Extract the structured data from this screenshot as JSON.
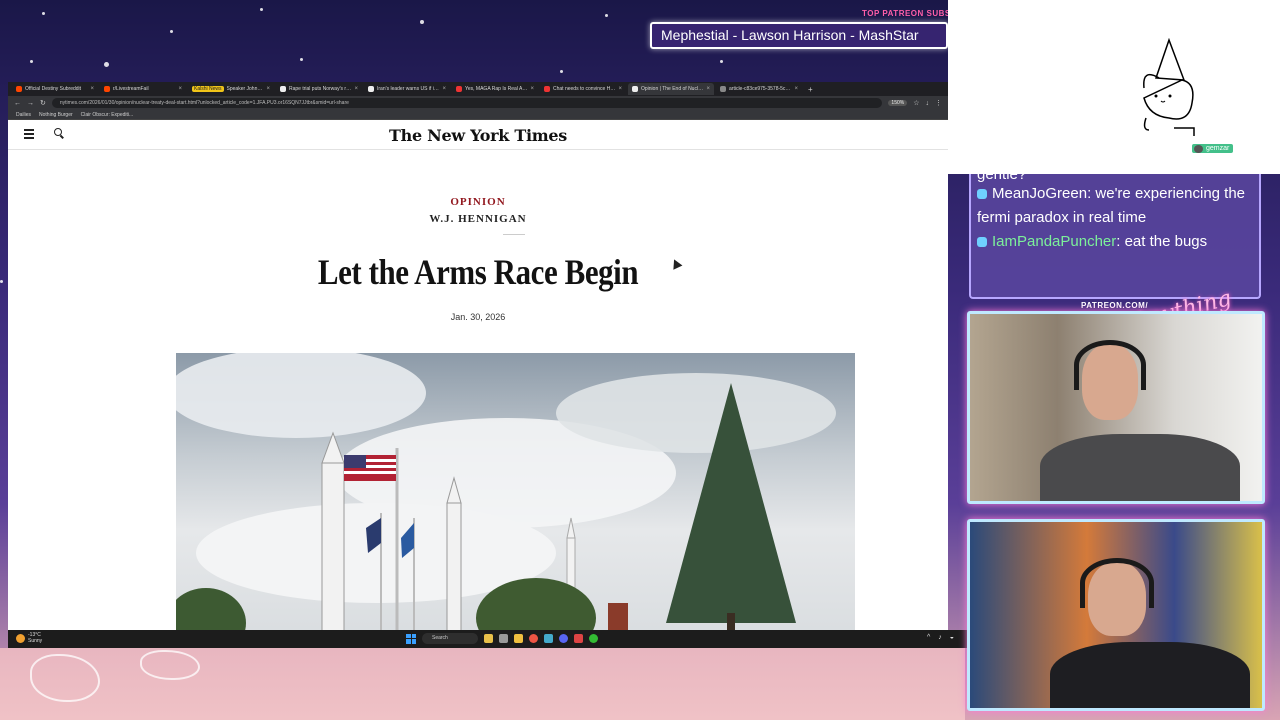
{
  "overlay": {
    "patreon_subs_label": "TOP PATREON SUBS",
    "marquee_text": "Mephestial - Lawson Harrison - MashStar",
    "patreon_url_label": "PATREON.COM/",
    "logo_text": "Anything Else?",
    "user_tag": "gemzar"
  },
  "browser": {
    "tabs": [
      {
        "label": "Official Destiny Subreddit",
        "color": "#ff4500",
        "active": false
      },
      {
        "label": "r/LivestreamFail",
        "color": "#ff4500",
        "active": false
      },
      {
        "label": "Speaker Johnson is 'confident' ...",
        "color": "#555",
        "active": false,
        "badge": "Kalshi News"
      },
      {
        "label": "Rape trial puts Norway's royal ...",
        "color": "#eee",
        "active": false
      },
      {
        "label": "Iran's leader warns US if it start...",
        "color": "#eee",
        "active": false
      },
      {
        "label": "Yes, MAGA Rap Is Real And Tru...",
        "color": "#e33",
        "active": false
      },
      {
        "label": "Chat needs to convince Hasan ...",
        "color": "#e33",
        "active": false
      },
      {
        "label": "Opinion | The End of Nuclear A...",
        "color": "#eee",
        "active": true
      },
      {
        "label": "article-c83ce975-3578-5cc...",
        "color": "#888",
        "active": false
      }
    ],
    "url": "nytimes.com/2026/01/30/opinion/nuclear-treaty-deal-start.html?unlocked_article_code=1.JFA.PU3.or16SQN7JJtbr&smid=url-share",
    "zoom": "150%",
    "bookmarks": [
      "Dailies",
      "Nothing Burger",
      "Clair Obscur: Expediti..."
    ]
  },
  "article": {
    "logo": "The New York Times",
    "kicker": "OPINION",
    "byline": "W.J. HENNIGAN",
    "headline": "Let the Arms Race Begin",
    "date": "Jan. 30, 2026",
    "hero_alt": "Missile displays and flags at an Air Force base"
  },
  "taskbar": {
    "temp": "-13°C",
    "condition": "Sunny",
    "search": "Search"
  },
  "chat": {
    "partial_top": "gentle?",
    "messages": [
      {
        "user": "MeanJoGreen",
        "text": ": we're experiencing the fermi paradox in real time",
        "green": false
      },
      {
        "user": "IamPandaPuncher",
        "text": ": eat the bugs",
        "green": true
      }
    ]
  }
}
